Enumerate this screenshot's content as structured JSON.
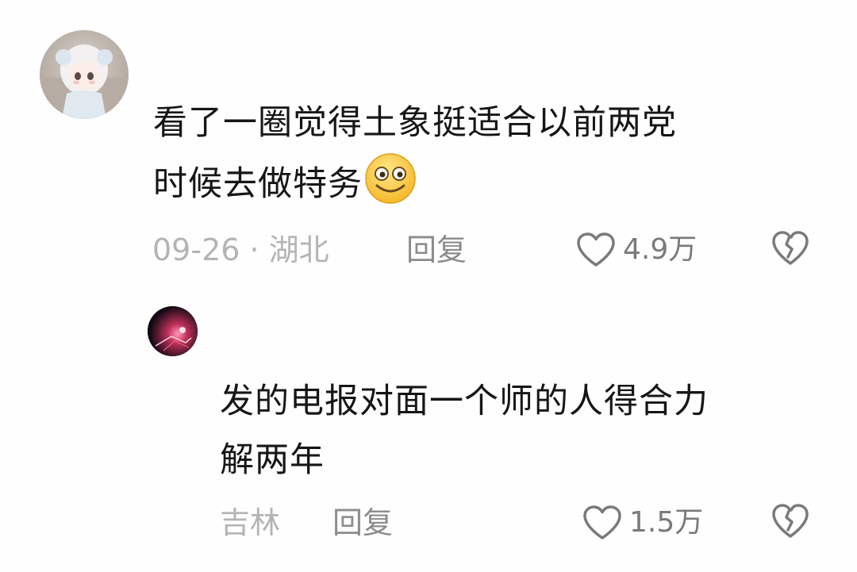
{
  "comments": [
    {
      "text_line1": "看了一圈觉得土象挺适合以前两党",
      "text_line2": "时候去做特务",
      "emoji": "smile-emoji",
      "meta": "09-26 · 湖北",
      "reply_label": "回复",
      "likes": "4.9万",
      "avatar": "doll-avatar"
    },
    {
      "text_line1": "发的电报对面一个师的人得合力",
      "text_line2": "解两年",
      "meta": "吉林",
      "reply_label": "回复",
      "likes": "1.5万",
      "avatar": "night-fire-avatar"
    }
  ],
  "icons": {
    "like": "heart-outline-icon",
    "dislike": "broken-heart-icon"
  },
  "colors": {
    "background": "#fefefe",
    "text": "#161616",
    "meta": "#b4b4b4",
    "reply": "#8c8c8c",
    "icon": "#7a7a7a"
  }
}
